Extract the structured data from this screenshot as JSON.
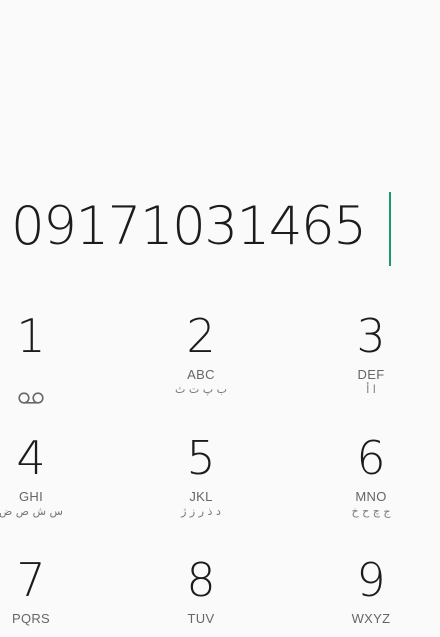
{
  "dialer": {
    "number": "09171031465"
  },
  "keys": [
    {
      "digit": "1",
      "letters": "",
      "arabic": "",
      "icon": "voicemail-icon"
    },
    {
      "digit": "2",
      "letters": "ABC",
      "arabic": "ب پ ت ث"
    },
    {
      "digit": "3",
      "letters": "DEF",
      "arabic": "ا أ"
    },
    {
      "digit": "4",
      "letters": "GHI",
      "arabic": "س ش ص ض"
    },
    {
      "digit": "5",
      "letters": "JKL",
      "arabic": "د ذ ر ز ژ"
    },
    {
      "digit": "6",
      "letters": "MNO",
      "arabic": "ج چ ح خ"
    },
    {
      "digit": "7",
      "letters": "PQRS",
      "arabic": ""
    },
    {
      "digit": "8",
      "letters": "TUV",
      "arabic": ""
    },
    {
      "digit": "9",
      "letters": "WXYZ",
      "arabic": ""
    }
  ],
  "colors": {
    "accent": "#1a9a6a",
    "background": "#fafafa",
    "text": "#1c1c1c",
    "subtext": "#666666"
  }
}
